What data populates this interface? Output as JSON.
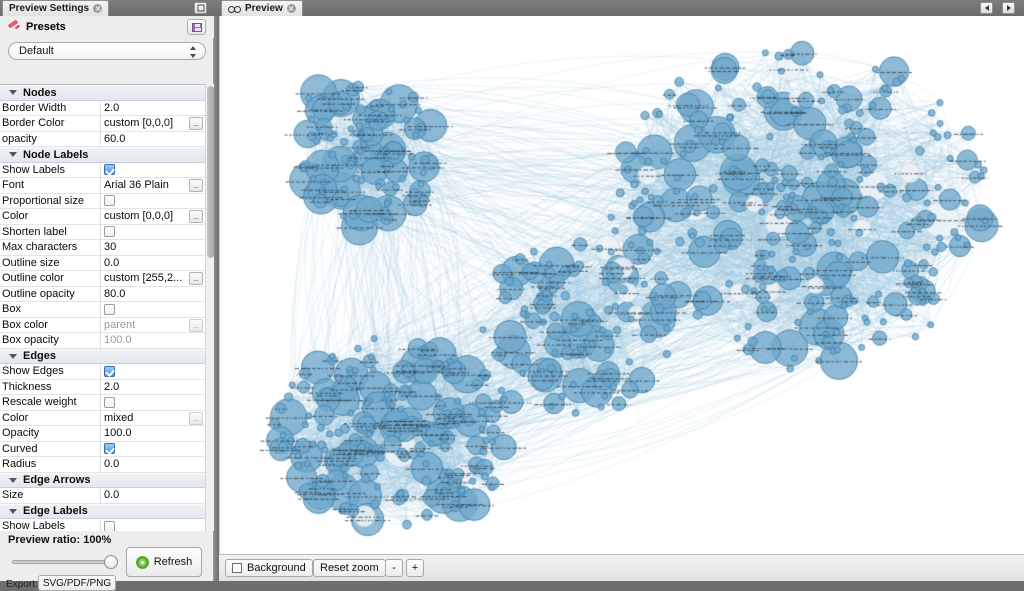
{
  "window": {
    "settings_tab": "Preview Settings",
    "preview_tab": "Preview",
    "minimize_label": "",
    "nav_prev": "",
    "nav_next": ""
  },
  "presets": {
    "header": "Presets",
    "save_icon": "floppy-disk-icon",
    "pin_icon": "pin-icon",
    "selected": "Default",
    "options": [
      "Default"
    ]
  },
  "properties": [
    {
      "type": "section",
      "label": "Nodes"
    },
    {
      "type": "text",
      "label": "Border Width",
      "value": "2.0"
    },
    {
      "type": "text",
      "label": "Border Color",
      "value": "custom [0,0,0]",
      "ellipsis": true
    },
    {
      "type": "text",
      "label": "opacity",
      "value": "60.0"
    },
    {
      "type": "section",
      "label": "Node Labels"
    },
    {
      "type": "checkbox",
      "label": "Show Labels",
      "checked": true
    },
    {
      "type": "text",
      "label": "Font",
      "value": "Arial 36 Plain",
      "ellipsis": true
    },
    {
      "type": "checkbox",
      "label": "Proportional size",
      "checked": false
    },
    {
      "type": "text",
      "label": "Color",
      "value": "custom [0,0,0]",
      "ellipsis": true
    },
    {
      "type": "checkbox",
      "label": "Shorten label",
      "checked": false
    },
    {
      "type": "text",
      "label": "Max characters",
      "value": "30"
    },
    {
      "type": "text",
      "label": "Outline size",
      "value": "0.0"
    },
    {
      "type": "text",
      "label": "Outline color",
      "value": "custom [255,2...",
      "ellipsis": true
    },
    {
      "type": "text",
      "label": "Outline opacity",
      "value": "80.0"
    },
    {
      "type": "checkbox",
      "label": "Box",
      "checked": false
    },
    {
      "type": "text",
      "label": "Box color",
      "value": "parent",
      "muted": true,
      "ellipsis": true,
      "ellipsis_dim": true
    },
    {
      "type": "text",
      "label": "Box opacity",
      "value": "100.0",
      "muted": true
    },
    {
      "type": "section",
      "label": "Edges"
    },
    {
      "type": "checkbox",
      "label": "Show Edges",
      "checked": true
    },
    {
      "type": "text",
      "label": "Thickness",
      "value": "2.0"
    },
    {
      "type": "checkbox",
      "label": "Rescale weight",
      "checked": false
    },
    {
      "type": "text",
      "label": "Color",
      "value": "mixed",
      "ellipsis": true,
      "ellipsis_dim": true
    },
    {
      "type": "text",
      "label": "Opacity",
      "value": "100.0"
    },
    {
      "type": "checkbox",
      "label": "Curved",
      "checked": true
    },
    {
      "type": "text",
      "label": "Radius",
      "value": "0.0"
    },
    {
      "type": "section",
      "label": "Edge Arrows"
    },
    {
      "type": "text",
      "label": "Size",
      "value": "0.0"
    },
    {
      "type": "section",
      "label": "Edge Labels"
    },
    {
      "type": "checkbox",
      "label": "Show Labels",
      "checked": false
    }
  ],
  "footer": {
    "ratio_label": "Preview ratio: 100%",
    "ratio_value": 100,
    "refresh_label": "Refresh",
    "refresh_icon": "recycle-icon",
    "export_label": "Export:",
    "export_button": "SVG/PDF/PNG"
  },
  "statusbar": {
    "background_label": "Background",
    "background_checked": false,
    "reset_zoom_label": "Reset zoom",
    "zoom_out_label": "-",
    "zoom_in_label": "+"
  },
  "graph": {
    "node_fill": "#6fa8cc",
    "node_fill_pale": "#eef3f7",
    "node_border": "#3f7fa8",
    "edge_color": "#9cc3de",
    "label_color": "#2f3a42",
    "background": "#ffffff",
    "node_count": 720,
    "clusters": [
      {
        "name": "upper-right",
        "cx": 0.72,
        "cy": 0.36,
        "rx": 0.24,
        "ry": 0.3,
        "n": 300
      },
      {
        "name": "upper-left",
        "cx": 0.18,
        "cy": 0.25,
        "rx": 0.09,
        "ry": 0.14,
        "n": 110
      },
      {
        "name": "lower-left",
        "cx": 0.22,
        "cy": 0.77,
        "rx": 0.15,
        "ry": 0.18,
        "n": 210
      },
      {
        "name": "middle-bridge",
        "cx": 0.44,
        "cy": 0.58,
        "rx": 0.12,
        "ry": 0.16,
        "n": 100
      }
    ]
  }
}
